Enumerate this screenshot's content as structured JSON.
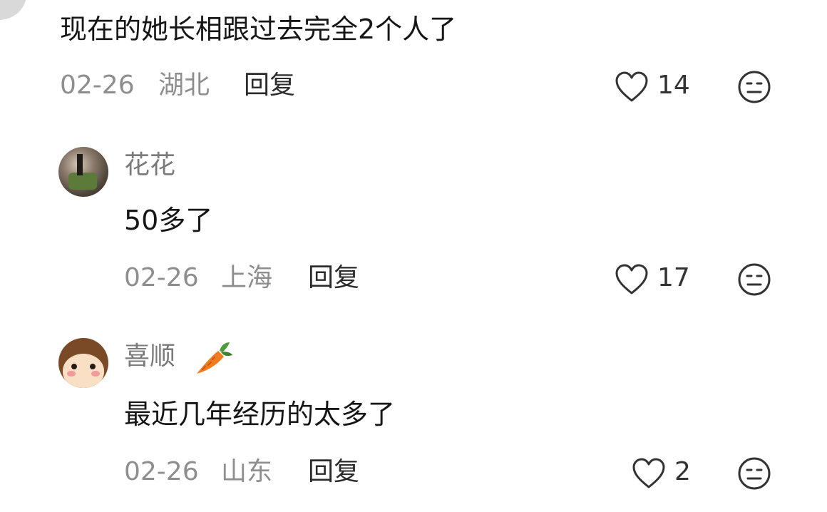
{
  "comments": [
    {
      "text": "现在的她长相跟过去完全2个人了",
      "date": "02-26",
      "location": "湖北",
      "reply_label": "回复",
      "likes": "14"
    },
    {
      "author": "花花",
      "text": "50多了",
      "date": "02-26",
      "location": "上海",
      "reply_label": "回复",
      "likes": "17"
    },
    {
      "author": "喜顺",
      "author_badge": "carrot-icon",
      "text": "最近几年经历的太多了",
      "date": "02-26",
      "location": "山东",
      "reply_label": "回复",
      "likes": "2"
    }
  ],
  "icons": {
    "like": "heart-icon",
    "dislike": "meh-face-icon"
  },
  "colors": {
    "meta_text": "#8e8e8e",
    "main_text": "#161616",
    "icon_stroke": "#333333",
    "carrot": "#f07c1e"
  }
}
